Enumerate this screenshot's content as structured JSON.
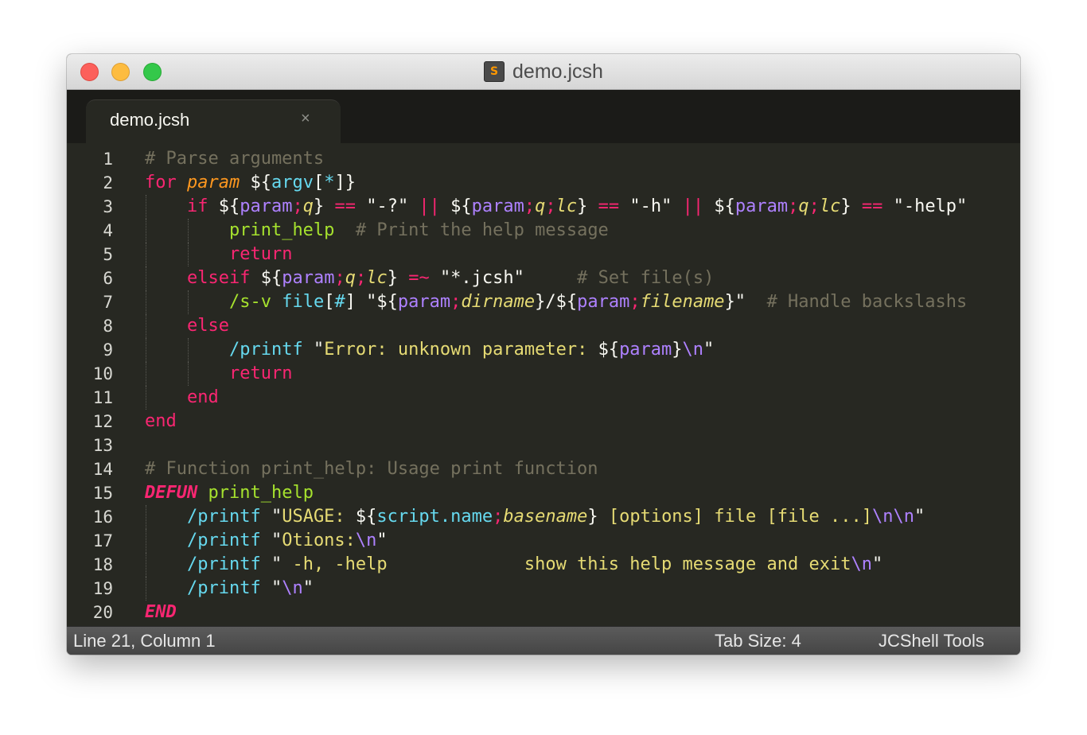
{
  "window": {
    "title": "demo.jcsh",
    "file_icon_letter": "S",
    "file_icon": "sublime-file-icon"
  },
  "tabs": [
    {
      "label": "demo.jcsh",
      "close_glyph": "×"
    }
  ],
  "editor": {
    "line_numbers": [
      "1",
      "2",
      "3",
      "4",
      "5",
      "6",
      "7",
      "8",
      "9",
      "10",
      "11",
      "12",
      "13",
      "14",
      "15",
      "16",
      "17",
      "18",
      "19",
      "20"
    ],
    "lines": [
      [
        {
          "t": "# Parse arguments",
          "c": "cm"
        }
      ],
      [
        {
          "t": "for",
          "c": "kw"
        },
        {
          "t": " ",
          "c": "pl"
        },
        {
          "t": "param",
          "c": "it"
        },
        {
          "t": " ${",
          "c": "pl"
        },
        {
          "t": "argv",
          "c": "nv"
        },
        {
          "t": "[",
          "c": "pl"
        },
        {
          "t": "*",
          "c": "nv"
        },
        {
          "t": "]}",
          "c": "pl"
        }
      ],
      [
        {
          "t": "    ",
          "c": "pl"
        },
        {
          "t": "if",
          "c": "kw"
        },
        {
          "t": " ${",
          "c": "pl"
        },
        {
          "t": "param",
          "c": "pp"
        },
        {
          "t": ";",
          "c": "op"
        },
        {
          "t": "q",
          "c": "ib"
        },
        {
          "t": "}",
          "c": "pl"
        },
        {
          "t": " == ",
          "c": "op"
        },
        {
          "t": "\"-?\"",
          "c": "pl"
        },
        {
          "t": " || ",
          "c": "op"
        },
        {
          "t": "${",
          "c": "pl"
        },
        {
          "t": "param",
          "c": "pp"
        },
        {
          "t": ";",
          "c": "op"
        },
        {
          "t": "q",
          "c": "ib"
        },
        {
          "t": ";",
          "c": "op"
        },
        {
          "t": "lc",
          "c": "ib"
        },
        {
          "t": "}",
          "c": "pl"
        },
        {
          "t": " == ",
          "c": "op"
        },
        {
          "t": "\"-h\"",
          "c": "pl"
        },
        {
          "t": " || ",
          "c": "op"
        },
        {
          "t": "${",
          "c": "pl"
        },
        {
          "t": "param",
          "c": "pp"
        },
        {
          "t": ";",
          "c": "op"
        },
        {
          "t": "q",
          "c": "ib"
        },
        {
          "t": ";",
          "c": "op"
        },
        {
          "t": "lc",
          "c": "ib"
        },
        {
          "t": "}",
          "c": "pl"
        },
        {
          "t": " == ",
          "c": "op"
        },
        {
          "t": "\"-help\"",
          "c": "pl"
        }
      ],
      [
        {
          "t": "        ",
          "c": "pl"
        },
        {
          "t": "print_help",
          "c": "fn"
        },
        {
          "t": "  ",
          "c": "pl"
        },
        {
          "t": "# Print the help message",
          "c": "cm"
        }
      ],
      [
        {
          "t": "        ",
          "c": "pl"
        },
        {
          "t": "return",
          "c": "kw"
        }
      ],
      [
        {
          "t": "    ",
          "c": "pl"
        },
        {
          "t": "elseif",
          "c": "kw"
        },
        {
          "t": " ${",
          "c": "pl"
        },
        {
          "t": "param",
          "c": "pp"
        },
        {
          "t": ";",
          "c": "op"
        },
        {
          "t": "q",
          "c": "ib"
        },
        {
          "t": ";",
          "c": "op"
        },
        {
          "t": "lc",
          "c": "ib"
        },
        {
          "t": "}",
          "c": "pl"
        },
        {
          "t": " =~ ",
          "c": "op"
        },
        {
          "t": "\"*.jcsh\"",
          "c": "pl"
        },
        {
          "t": "     ",
          "c": "pl"
        },
        {
          "t": "# Set file(s)",
          "c": "cm"
        }
      ],
      [
        {
          "t": "        ",
          "c": "pl"
        },
        {
          "t": "/s-v",
          "c": "fn"
        },
        {
          "t": " ",
          "c": "pl"
        },
        {
          "t": "file",
          "c": "nv"
        },
        {
          "t": "[",
          "c": "pl"
        },
        {
          "t": "#",
          "c": "nv"
        },
        {
          "t": "] \"${",
          "c": "pl"
        },
        {
          "t": "param",
          "c": "pp"
        },
        {
          "t": ";",
          "c": "op"
        },
        {
          "t": "dirname",
          "c": "ib"
        },
        {
          "t": "}/${",
          "c": "pl"
        },
        {
          "t": "param",
          "c": "pp"
        },
        {
          "t": ";",
          "c": "op"
        },
        {
          "t": "filename",
          "c": "ib"
        },
        {
          "t": "}\"",
          "c": "pl"
        },
        {
          "t": "  ",
          "c": "pl"
        },
        {
          "t": "# Handle backslashs",
          "c": "cm"
        }
      ],
      [
        {
          "t": "    ",
          "c": "pl"
        },
        {
          "t": "else",
          "c": "kw"
        }
      ],
      [
        {
          "t": "        ",
          "c": "pl"
        },
        {
          "t": "/printf",
          "c": "nv"
        },
        {
          "t": " \"",
          "c": "pl"
        },
        {
          "t": "Error: unknown parameter: ",
          "c": "st"
        },
        {
          "t": "${",
          "c": "pl"
        },
        {
          "t": "param",
          "c": "pp"
        },
        {
          "t": "}",
          "c": "pl"
        },
        {
          "t": "\\n",
          "c": "pp"
        },
        {
          "t": "\"",
          "c": "pl"
        }
      ],
      [
        {
          "t": "        ",
          "c": "pl"
        },
        {
          "t": "return",
          "c": "kw"
        }
      ],
      [
        {
          "t": "    ",
          "c": "pl"
        },
        {
          "t": "end",
          "c": "kw"
        }
      ],
      [
        {
          "t": "end",
          "c": "kw"
        }
      ],
      [],
      [
        {
          "t": "# Function print_help: Usage print function",
          "c": "cm"
        }
      ],
      [
        {
          "t": "DEFUN",
          "c": "kwb"
        },
        {
          "t": " ",
          "c": "pl"
        },
        {
          "t": "print_help",
          "c": "fn"
        }
      ],
      [
        {
          "t": "    ",
          "c": "pl"
        },
        {
          "t": "/printf",
          "c": "nv"
        },
        {
          "t": " \"",
          "c": "pl"
        },
        {
          "t": "USAGE: ",
          "c": "st"
        },
        {
          "t": "${",
          "c": "pl"
        },
        {
          "t": "script.name",
          "c": "nv"
        },
        {
          "t": ";",
          "c": "op"
        },
        {
          "t": "basename",
          "c": "ib"
        },
        {
          "t": "}",
          "c": "pl"
        },
        {
          "t": " [options] file [file ...]",
          "c": "st"
        },
        {
          "t": "\\n\\n",
          "c": "pp"
        },
        {
          "t": "\"",
          "c": "pl"
        }
      ],
      [
        {
          "t": "    ",
          "c": "pl"
        },
        {
          "t": "/printf",
          "c": "nv"
        },
        {
          "t": " \"",
          "c": "pl"
        },
        {
          "t": "Otions:",
          "c": "st"
        },
        {
          "t": "\\n",
          "c": "pp"
        },
        {
          "t": "\"",
          "c": "pl"
        }
      ],
      [
        {
          "t": "    ",
          "c": "pl"
        },
        {
          "t": "/printf",
          "c": "nv"
        },
        {
          "t": " \"",
          "c": "pl"
        },
        {
          "t": " -h, -help             show this help message and exit",
          "c": "st"
        },
        {
          "t": "\\n",
          "c": "pp"
        },
        {
          "t": "\"",
          "c": "pl"
        }
      ],
      [
        {
          "t": "    ",
          "c": "pl"
        },
        {
          "t": "/printf",
          "c": "nv"
        },
        {
          "t": " \"",
          "c": "pl"
        },
        {
          "t": "\\n",
          "c": "pp"
        },
        {
          "t": "\"",
          "c": "pl"
        }
      ],
      [
        {
          "t": "END",
          "c": "kwb"
        }
      ]
    ]
  },
  "statusbar": {
    "position": "Line 21, Column 1",
    "tab_size": "Tab Size: 4",
    "syntax": "JCShell Tools"
  },
  "colors": {
    "editor_background": "#272822",
    "comment": "#75715e",
    "keyword": "#f92672",
    "function": "#a6e22e",
    "variable": "#66d9ef",
    "parameter": "#ae81ff",
    "string": "#e6db74",
    "accent": "#fd971f"
  }
}
